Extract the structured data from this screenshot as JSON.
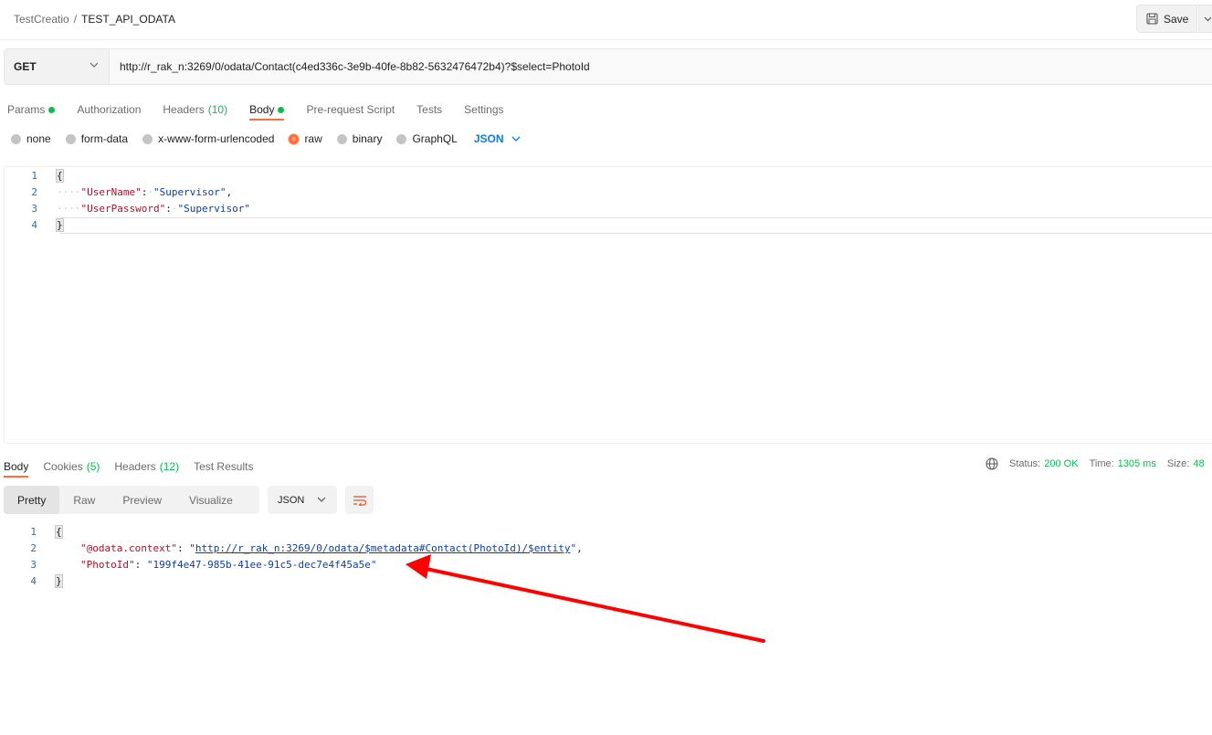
{
  "breadcrumb": {
    "parent": "TestCreatio",
    "separator": "/",
    "current": "TEST_API_ODATA"
  },
  "save": {
    "label": "Save"
  },
  "request": {
    "method": "GET",
    "url": "http://r_rak_n:3269/0/odata/Contact(c4ed336c-3e9b-40fe-8b82-5632476472b4)?$select=PhotoId"
  },
  "request_tabs": {
    "params": "Params",
    "authorization": "Authorization",
    "headers": "Headers",
    "headers_count": "(10)",
    "body": "Body",
    "prerequest": "Pre-request Script",
    "tests": "Tests",
    "settings": "Settings"
  },
  "body_types": {
    "none": "none",
    "form_data": "form-data",
    "urlencoded": "x-www-form-urlencoded",
    "raw": "raw",
    "binary": "binary",
    "graphql": "GraphQL",
    "language": "JSON"
  },
  "request_body": {
    "line_numbers": [
      "1",
      "2",
      "3",
      "4"
    ],
    "open": "{",
    "close": "}",
    "indent": "····",
    "colon_sep": ":·",
    "key1": "\"UserName\"",
    "val1": "\"Supervisor\"",
    "key2": "\"UserPassword\"",
    "val2": "\"Supervisor\""
  },
  "response_tabs": {
    "body": "Body",
    "cookies": "Cookies",
    "cookies_count": "(5)",
    "headers": "Headers",
    "headers_count": "(12)",
    "test_results": "Test Results"
  },
  "response_status": {
    "status_label": "Status:",
    "status_value": "200 OK",
    "time_label": "Time:",
    "time_value": "1305 ms",
    "size_label": "Size:",
    "size_value": "48"
  },
  "view_tabs": {
    "pretty": "Pretty",
    "raw": "Raw",
    "preview": "Preview",
    "visualize": "Visualize",
    "format": "JSON"
  },
  "response_body": {
    "line_numbers": [
      "1",
      "2",
      "3",
      "4"
    ],
    "open": "{",
    "close": "}",
    "key1": "\"@odata.context\"",
    "val1_q": "\"",
    "val1_link": "http://r_rak_n:3269/0/odata/$metadata#Contact(PhotoId)/$entity",
    "key2": "\"PhotoId\"",
    "val2": "\"199f4e47-985b-41ee-91c5-dec7e4f45a5e\""
  },
  "colors": {
    "accent": "#ff6c37",
    "success": "#0cbb52",
    "link": "#097bed",
    "annotation_arrow": "#ff0000"
  }
}
